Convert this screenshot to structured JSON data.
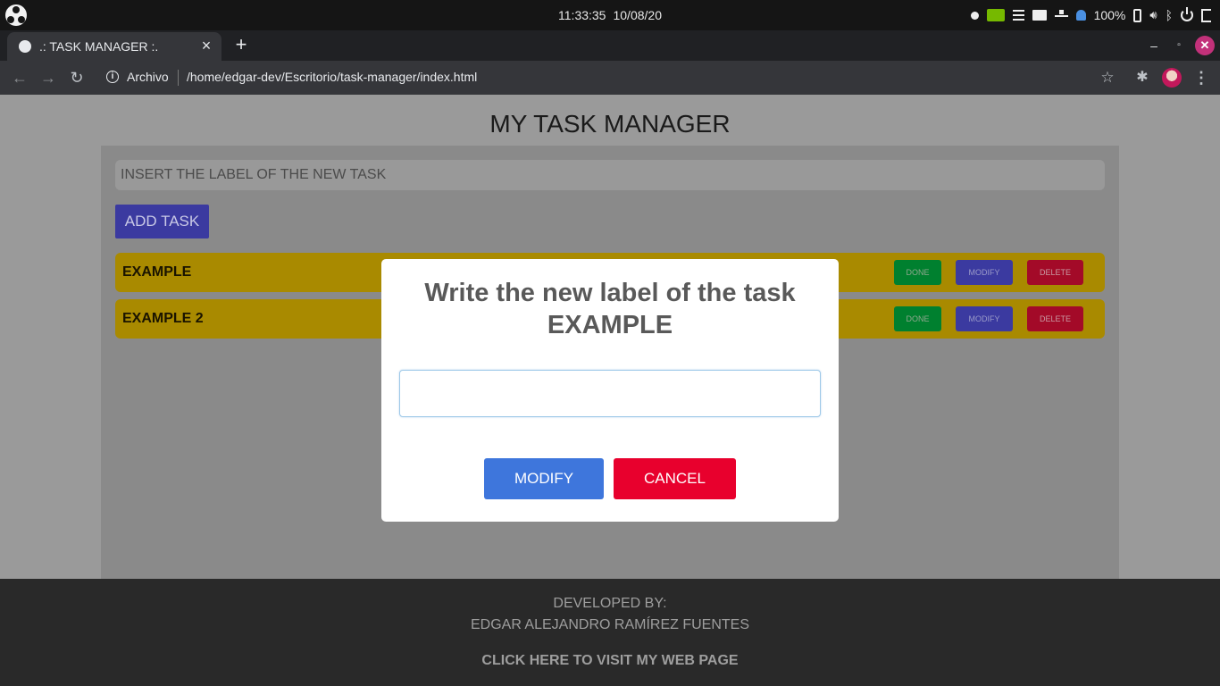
{
  "os": {
    "time": "11:33:35",
    "date": "10/08/20",
    "battery": "100%",
    "icons": [
      "menu-icon",
      "nvidia-icon",
      "folder-icon",
      "network-icon",
      "notification-icon",
      "battery-icon",
      "volume-icon",
      "bluetooth-icon",
      "power-icon",
      "logout-icon"
    ]
  },
  "browser": {
    "tab_title": ".: TASK MANAGER :.",
    "tab_close": "×",
    "new_tab": "+",
    "win_min": "–",
    "win_max": "▫",
    "win_close": "✕",
    "back": "←",
    "forward": "→",
    "reload": "↻",
    "info": "i",
    "url_label": "Archivo",
    "url": "/home/edgar-dev/Escritorio/task-manager/index.html",
    "star": "☆",
    "extensions": "✱",
    "menu": "⋮"
  },
  "app": {
    "title": "MY TASK MANAGER",
    "input_placeholder": "INSERT THE LABEL OF THE NEW TASK",
    "add_button": "ADD TASK",
    "tasks": [
      {
        "label": "EXAMPLE",
        "done": "DONE",
        "modify": "MODIFY",
        "delete": "DELETE"
      },
      {
        "label": "EXAMPLE 2",
        "done": "DONE",
        "modify": "MODIFY",
        "delete": "DELETE"
      }
    ]
  },
  "modal": {
    "title_line1": "Write the new label of the task",
    "title_line2": "EXAMPLE",
    "input_value": "",
    "confirm": "MODIFY",
    "cancel": "CANCEL"
  },
  "footer": {
    "line1": "DEVELOPED BY:",
    "line2": "EDGAR ALEJANDRO RAMÍREZ FUENTES",
    "link": "CLICK HERE TO VISIT MY WEB PAGE"
  },
  "colors": {
    "task_bg": "#a98a00",
    "add_button": "#3b3aa0",
    "modal_confirm": "#3e76dc",
    "modal_cancel": "#e8002d",
    "footer_bg": "#292929"
  }
}
